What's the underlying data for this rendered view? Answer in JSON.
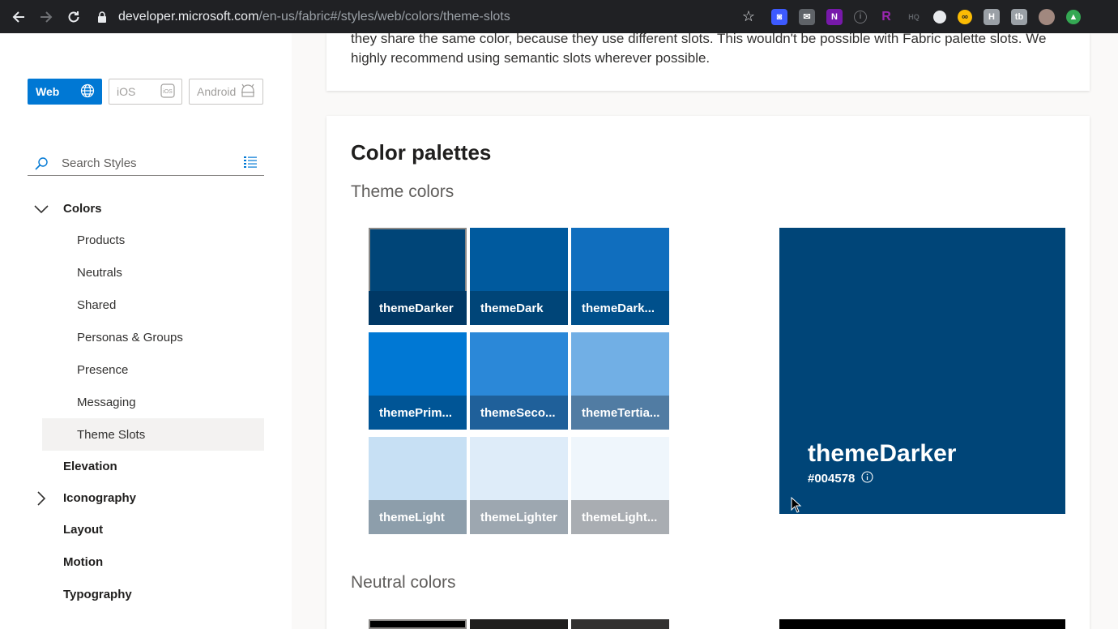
{
  "browser": {
    "url_host": "developer.microsoft.com",
    "url_path": "/en-us/fabric#/styles/web/colors/theme-slots",
    "extensions": [
      "camera-icon",
      "mail-icon",
      "onenote-icon",
      "info-icon",
      "r-icon",
      "hq-icon",
      "circle-icon",
      "glasses-icon",
      "h-icon",
      "tb-icon",
      "avatar",
      "green-icon"
    ]
  },
  "sidebar": {
    "platforms": [
      {
        "label": "Web",
        "icon": "globe-icon",
        "active": true
      },
      {
        "label": "iOS",
        "icon": "ios-icon",
        "active": false
      },
      {
        "label": "Android",
        "icon": "android-icon",
        "active": false
      }
    ],
    "search_placeholder": "Search Styles",
    "items": [
      {
        "label": "Colors",
        "level": 0,
        "expanded": true
      },
      {
        "label": "Products",
        "level": 1
      },
      {
        "label": "Neutrals",
        "level": 1
      },
      {
        "label": "Shared",
        "level": 1
      },
      {
        "label": "Personas & Groups",
        "level": 1
      },
      {
        "label": "Presence",
        "level": 1
      },
      {
        "label": "Messaging",
        "level": 1
      },
      {
        "label": "Theme Slots",
        "level": 1,
        "selected": true
      },
      {
        "label": "Elevation",
        "level": 0
      },
      {
        "label": "Iconography",
        "level": 0,
        "collapsed": true
      },
      {
        "label": "Layout",
        "level": 0
      },
      {
        "label": "Motion",
        "level": 0
      },
      {
        "label": "Typography",
        "level": 0
      }
    ]
  },
  "main": {
    "intro_text": "they share the same color, because they use different slots. This wouldn't be possible with Fabric palette slots. We highly recommend using semantic slots wherever possible.",
    "palettes_title": "Color palettes",
    "theme_colors_title": "Theme colors",
    "neutral_colors_title": "Neutral colors",
    "theme_swatches": [
      {
        "label": "themeDarker",
        "color": "#004578",
        "label_bg": "#003865",
        "selected": true
      },
      {
        "label": "themeDark",
        "color": "#005a9e",
        "label_bg": "#004578"
      },
      {
        "label": "themeDark...",
        "color": "#106ebe",
        "label_bg": "#00508c"
      },
      {
        "label": "themePrim...",
        "color": "#0078d4",
        "label_bg": "#005596"
      },
      {
        "label": "themeSeco...",
        "color": "#2b88d8",
        "label_bg": "#1f609a"
      },
      {
        "label": "themeTertia...",
        "color": "#71afe5",
        "label_bg": "#517ca3"
      },
      {
        "label": "themeLight",
        "color": "#c7e0f4",
        "label_bg": "#8d9eab"
      },
      {
        "label": "themeLighter",
        "color": "#deecf9",
        "label_bg": "#9da7b0"
      },
      {
        "label": "themeLight...",
        "color": "#eff6fc",
        "label_bg": "#a9adb2"
      }
    ],
    "neutral_swatches_partial": [
      "#000000",
      "#201f1e",
      "#323130"
    ],
    "preview": {
      "name": "themeDarker",
      "hex": "#004578",
      "color": "#004578"
    },
    "neutral_preview_color": "#000000"
  }
}
